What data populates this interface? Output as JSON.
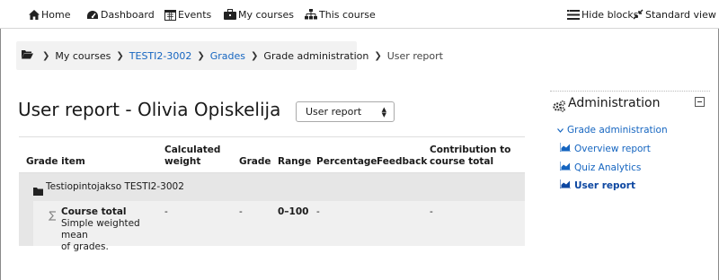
{
  "navbar": {
    "items": [
      {
        "label": "Home",
        "icon": "home-icon"
      },
      {
        "label": "Dashboard",
        "icon": "dashboard-icon"
      },
      {
        "label": "Events",
        "icon": "calendar-icon"
      },
      {
        "label": "My courses",
        "icon": "briefcase-icon"
      },
      {
        "label": "This course",
        "icon": "sitemap-icon"
      }
    ],
    "hide_blocks": "Hide blocks",
    "standard_view": "Standard view"
  },
  "breadcrumb": {
    "items": [
      "My courses",
      "TESTI2-3002",
      "Grades",
      "Grade administration",
      "User report"
    ]
  },
  "page": {
    "title": "User report - Olivia Opiskelija",
    "report_select": "User report"
  },
  "table": {
    "headers": {
      "grade_item": "Grade item",
      "weight_line1": "Calculated",
      "weight_line2": "weight",
      "grade": "Grade",
      "range": "Range",
      "percentage": "Percentage",
      "feedback": "Feedback",
      "contribution_line1": "Contribution to",
      "contribution_line2": "course total"
    },
    "category": "Testiopintojakso TESTI2-3002",
    "course_total": {
      "name": "Course total",
      "desc_line1": "Simple weighted mean",
      "desc_line2": "of grades.",
      "weight": "-",
      "grade": "-",
      "range": "0–100",
      "percentage": "-",
      "feedback": "",
      "contribution": "-"
    }
  },
  "admin_block": {
    "title": "Administration",
    "section": "Grade administration",
    "items": [
      "Overview report",
      "Quiz Analytics",
      "User report"
    ]
  },
  "colors": {
    "link": "#1565c0",
    "header_bg": "#e6e6e6",
    "row_bg": "#f0f0f0"
  }
}
